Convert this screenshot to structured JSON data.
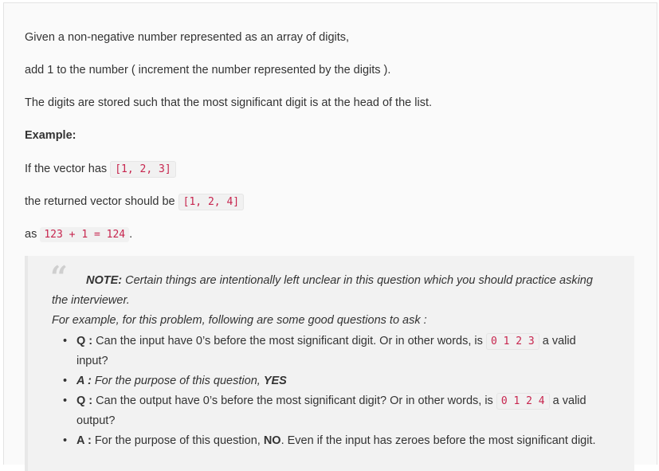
{
  "content": {
    "line1": "Given a non-negative number represented as an array of digits,",
    "line2": "add 1 to the number ( increment the number represented by the digits ).",
    "line3": "The digits are stored such that the most significant digit is at the head of the list.",
    "example_heading": "Example:",
    "vector_prefix": "If the vector has",
    "vector_input": "[1, 2, 3]",
    "returned_prefix": "the returned vector should be",
    "vector_output": "[1, 2, 4]",
    "as_prefix": "as",
    "as_expr": "123 + 1 = 124",
    "as_suffix": "."
  },
  "note": {
    "quote_glyph": "“",
    "label": "NOTE:",
    "text1": " Certain things are intentionally left unclear in this question which you should practice asking",
    "text2": "the interviewer.",
    "text3": "For example, for this problem, following are some good questions to ask :",
    "items": [
      {
        "prefix": "Q :",
        "text": " Can the input have 0’s before the most significant digit. Or in other words, is ",
        "code": "0 1 2 3",
        "suffix": " a valid",
        "wrap": "input?"
      },
      {
        "prefix": "A :",
        "text": " For the purpose of this question, ",
        "emph": "YES"
      },
      {
        "prefix": "Q :",
        "text": " Can the output have 0’s before the most significant digit? Or in other words, is ",
        "code": "0 1 2 4",
        "suffix": " a valid",
        "wrap": "output?"
      },
      {
        "prefix": "A :",
        "text": " For the purpose of this question, ",
        "emph": "NO",
        "after": ". Even if the input has zeroes before the most significant digit."
      }
    ],
    "bullet": "•"
  }
}
